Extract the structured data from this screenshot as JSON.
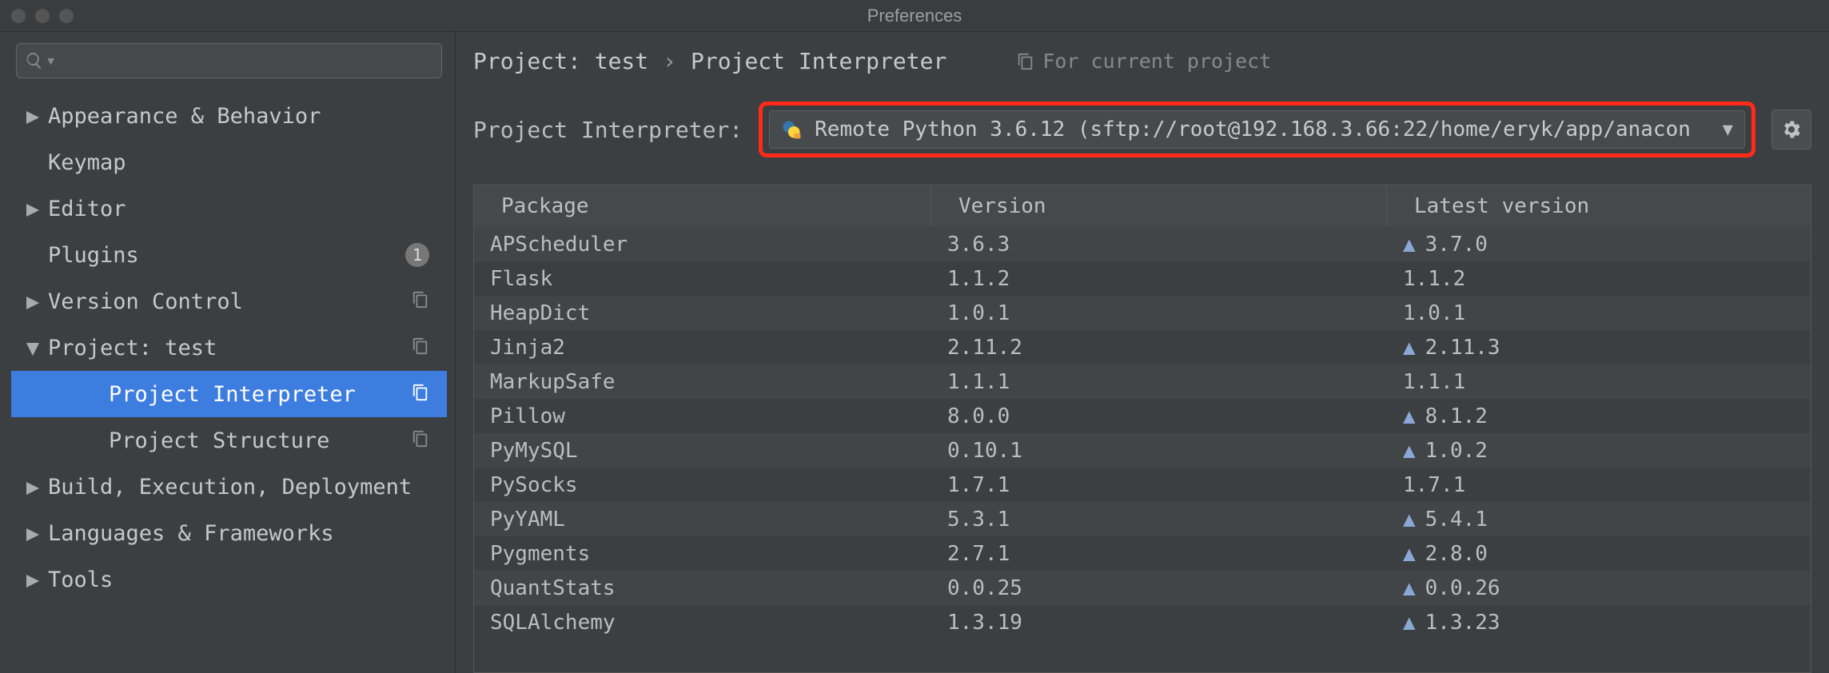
{
  "window": {
    "title": "Preferences"
  },
  "sidebar": {
    "search_placeholder": "",
    "items": [
      {
        "label": "Appearance & Behavior",
        "expandable": true,
        "expanded": false
      },
      {
        "label": "Keymap",
        "expandable": false
      },
      {
        "label": "Editor",
        "expandable": true,
        "expanded": false
      },
      {
        "label": "Plugins",
        "expandable": false,
        "badge": "1"
      },
      {
        "label": "Version Control",
        "expandable": true,
        "expanded": false,
        "projectScope": true
      },
      {
        "label": "Project: test",
        "expandable": true,
        "expanded": true,
        "projectScope": true
      },
      {
        "label": "Project Interpreter",
        "child": true,
        "selected": true,
        "projectScope": true
      },
      {
        "label": "Project Structure",
        "child": true,
        "projectScope": true
      },
      {
        "label": "Build, Execution, Deployment",
        "expandable": true,
        "expanded": false
      },
      {
        "label": "Languages & Frameworks",
        "expandable": true,
        "expanded": false
      },
      {
        "label": "Tools",
        "expandable": true,
        "expanded": false
      }
    ]
  },
  "breadcrumb": {
    "root": "Project: test",
    "leaf": "Project Interpreter",
    "scope": "For current project"
  },
  "interpreter": {
    "label": "Project Interpreter:",
    "selected": "Remote Python 3.6.12 (sftp://root@192.168.3.66:22/home/eryk/app/anacon"
  },
  "table": {
    "headers": {
      "package": "Package",
      "version": "Version",
      "latest": "Latest version"
    },
    "rows": [
      {
        "name": "APScheduler",
        "version": "3.6.3",
        "latest": "3.7.0",
        "upgrade": true
      },
      {
        "name": "Flask",
        "version": "1.1.2",
        "latest": "1.1.2",
        "upgrade": false
      },
      {
        "name": "HeapDict",
        "version": "1.0.1",
        "latest": "1.0.1",
        "upgrade": false
      },
      {
        "name": "Jinja2",
        "version": "2.11.2",
        "latest": "2.11.3",
        "upgrade": true
      },
      {
        "name": "MarkupSafe",
        "version": "1.1.1",
        "latest": "1.1.1",
        "upgrade": false
      },
      {
        "name": "Pillow",
        "version": "8.0.0",
        "latest": "8.1.2",
        "upgrade": true
      },
      {
        "name": "PyMySQL",
        "version": "0.10.1",
        "latest": "1.0.2",
        "upgrade": true
      },
      {
        "name": "PySocks",
        "version": "1.7.1",
        "latest": "1.7.1",
        "upgrade": false
      },
      {
        "name": "PyYAML",
        "version": "5.3.1",
        "latest": "5.4.1",
        "upgrade": true
      },
      {
        "name": "Pygments",
        "version": "2.7.1",
        "latest": "2.8.0",
        "upgrade": true
      },
      {
        "name": "QuantStats",
        "version": "0.0.25",
        "latest": "0.0.26",
        "upgrade": true
      },
      {
        "name": "SQLAlchemy",
        "version": "1.3.19",
        "latest": "1.3.23",
        "upgrade": true
      }
    ]
  }
}
